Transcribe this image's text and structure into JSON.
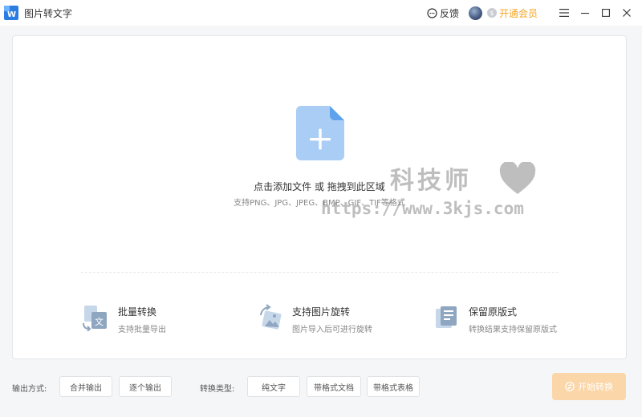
{
  "app": {
    "title": "图片转文字"
  },
  "header": {
    "feedback_label": "反馈",
    "vip_label": "开通会员"
  },
  "dropzone": {
    "main_text": "点击添加文件 或 拖拽到此区域",
    "sub_text": "支持PNG、JPG、JPEG、BMP、GIF、TIF等格式"
  },
  "features": [
    {
      "title": "批量转换",
      "desc": "支持批量导出"
    },
    {
      "title": "支持图片旋转",
      "desc": "图片导入后可进行旋转"
    },
    {
      "title": "保留原版式",
      "desc": "转换结果支持保留原版式"
    }
  ],
  "watermark": {
    "main": "科技师",
    "url": "https://www.3kjs.com"
  },
  "bottom": {
    "output_label": "输出方式:",
    "output_options": [
      "合并输出",
      "逐个输出"
    ],
    "type_label": "转换类型:",
    "type_options": [
      "纯文字",
      "带格式文档",
      "带格式表格"
    ],
    "start_label": "开始转换"
  },
  "colors": {
    "accent": "#f5a623",
    "start_button": "#fbd6a8",
    "file_icon": "#a9cdf5"
  }
}
